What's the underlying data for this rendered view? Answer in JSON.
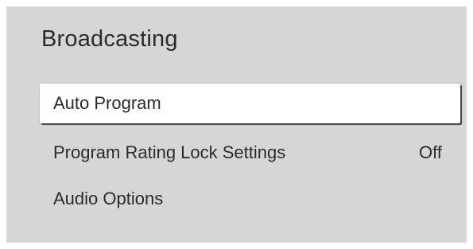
{
  "menu": {
    "title": "Broadcasting",
    "items": [
      {
        "label": "Auto Program",
        "value": "",
        "focused": true
      },
      {
        "label": "Program Rating Lock Settings",
        "value": "Off",
        "focused": false
      },
      {
        "label": "Audio Options",
        "value": "",
        "focused": false
      }
    ]
  },
  "colors": {
    "panel_background": "#d6d6d6",
    "text": "#2b2b2b",
    "focus_background": "#ffffff",
    "focus_shadow": "#4a4a4a"
  }
}
